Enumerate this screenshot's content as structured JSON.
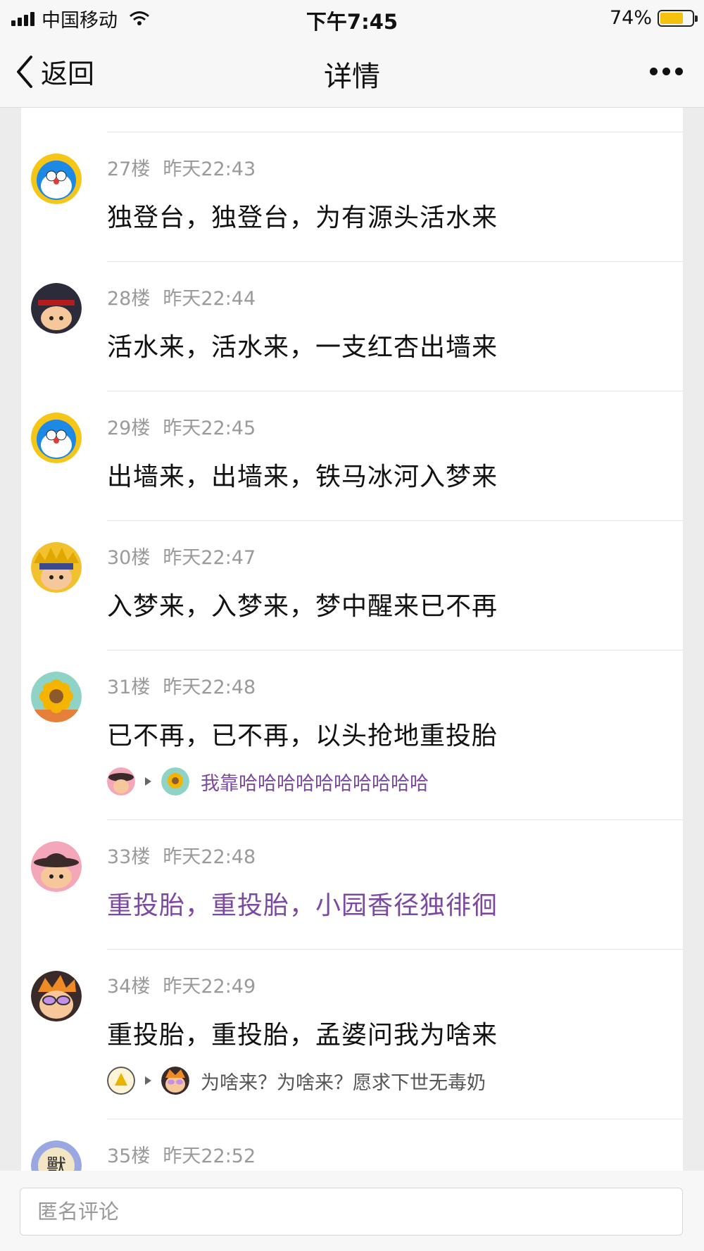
{
  "status_bar": {
    "carrier": "中国移动",
    "time": "下午7:45",
    "battery": "74%",
    "battery_level": 0.74
  },
  "nav": {
    "back_label": "返回",
    "title": "详情"
  },
  "comments": [
    {
      "floor": "27楼",
      "time": "昨天22:43",
      "text": "独登台，独登台，为有源头活水来",
      "avatar": "doraemon-avatar"
    },
    {
      "floor": "28楼",
      "time": "昨天22:44",
      "text": "活水来，活水来，一支红杏出墙来",
      "avatar": "black-hat-avatar"
    },
    {
      "floor": "29楼",
      "time": "昨天22:45",
      "text": "出墙来，出墙来，铁马冰河入梦来",
      "avatar": "doraemon-avatar"
    },
    {
      "floor": "30楼",
      "time": "昨天22:47",
      "text": "入梦来，入梦来，梦中醒来已不再",
      "avatar": "ninja-avatar"
    },
    {
      "floor": "31楼",
      "time": "昨天22:48",
      "text": "已不再，已不再，以头抢地重投胎",
      "avatar": "sunflower-avatar",
      "reply": {
        "text": "我靠哈哈哈哈哈哈哈哈哈哈"
      }
    },
    {
      "floor": "33楼",
      "time": "昨天22:48",
      "text": "重投胎，重投胎，小园香径独徘徊",
      "avatar": "hat-avatar"
    },
    {
      "floor": "34楼",
      "time": "昨天22:49",
      "text": "重投胎，重投胎，孟婆问我为啥来",
      "avatar": "sunglasses-avatar",
      "reply": {
        "text": "为啥来？为啥来？愿求下世无毒奶"
      }
    },
    {
      "floor": "35楼",
      "time": "昨天22:52",
      "text": "",
      "avatar": "beast-avatar"
    }
  ],
  "input": {
    "placeholder": "匿名评论"
  },
  "colors": {
    "purple_text": "#7b4aa0",
    "meta_gray": "#9a9a9a"
  }
}
